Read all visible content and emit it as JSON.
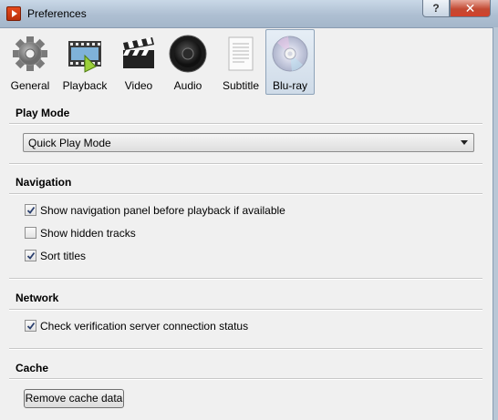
{
  "window": {
    "title": "Preferences",
    "help_label": "?",
    "close_label": "✕"
  },
  "toolbar": {
    "items": [
      {
        "label": "General",
        "icon": "gear-icon",
        "selected": false
      },
      {
        "label": "Playback",
        "icon": "film-play-icon",
        "selected": false
      },
      {
        "label": "Video",
        "icon": "clapperboard-icon",
        "selected": false
      },
      {
        "label": "Audio",
        "icon": "speaker-icon",
        "selected": false
      },
      {
        "label": "Subtitle",
        "icon": "document-icon",
        "selected": false
      },
      {
        "label": "Blu-ray",
        "icon": "disc-icon",
        "selected": true
      }
    ]
  },
  "play_mode": {
    "title": "Play Mode",
    "selected": "Quick Play Mode"
  },
  "navigation": {
    "title": "Navigation",
    "options": [
      {
        "label": "Show navigation panel before playback if available",
        "checked": true
      },
      {
        "label": "Show hidden tracks",
        "checked": false
      },
      {
        "label": "Sort titles",
        "checked": true
      }
    ]
  },
  "network": {
    "title": "Network",
    "options": [
      {
        "label": "Check verification server connection status",
        "checked": true
      }
    ]
  },
  "cache": {
    "title": "Cache",
    "remove_button": "Remove cache data"
  }
}
